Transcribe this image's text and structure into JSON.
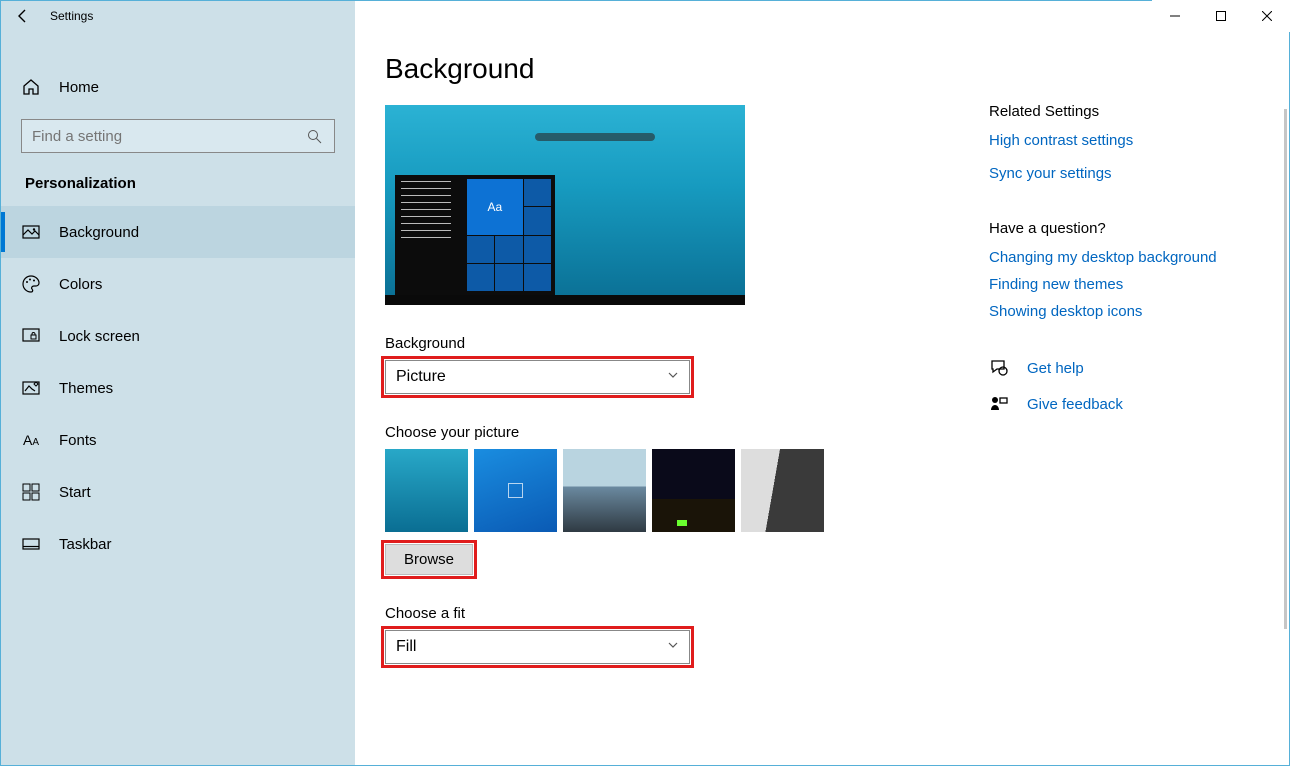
{
  "window": {
    "title": "Settings"
  },
  "sidebar": {
    "home": "Home",
    "search_placeholder": "Find a setting",
    "category": "Personalization",
    "items": [
      {
        "label": "Background",
        "selected": true
      },
      {
        "label": "Colors"
      },
      {
        "label": "Lock screen"
      },
      {
        "label": "Themes"
      },
      {
        "label": "Fonts"
      },
      {
        "label": "Start"
      },
      {
        "label": "Taskbar"
      }
    ]
  },
  "page": {
    "heading": "Background",
    "preview_sample": "Aa",
    "bg_label": "Background",
    "bg_value": "Picture",
    "choose_label": "Choose your picture",
    "browse": "Browse",
    "fit_label": "Choose a fit",
    "fit_value": "Fill"
  },
  "related": {
    "heading": "Related Settings",
    "links": [
      "High contrast settings",
      "Sync your settings"
    ]
  },
  "question": {
    "heading": "Have a question?",
    "links": [
      "Changing my desktop background",
      "Finding new themes",
      "Showing desktop icons"
    ]
  },
  "help": {
    "get_help": "Get help",
    "feedback": "Give feedback"
  }
}
